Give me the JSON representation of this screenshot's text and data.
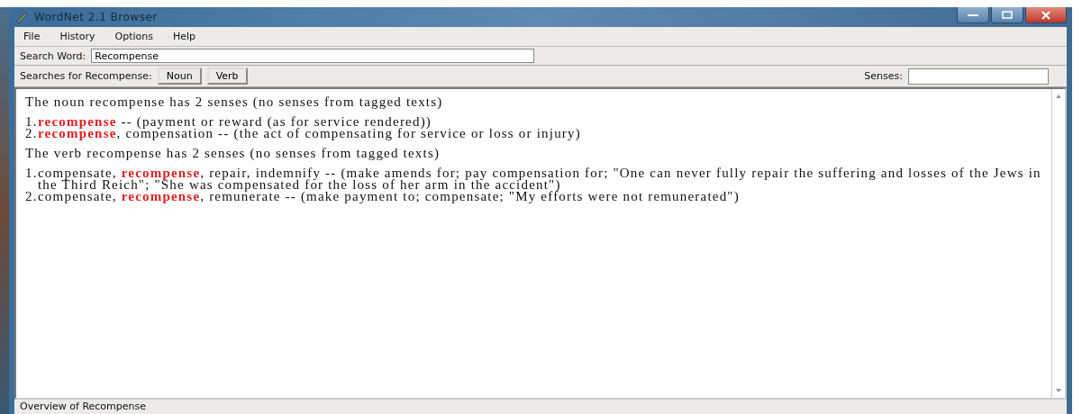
{
  "window": {
    "title": "WordNet 2.1 Browser"
  },
  "menu": [
    "File",
    "History",
    "Options",
    "Help"
  ],
  "search": {
    "label": "Search Word:",
    "value": "Recompense"
  },
  "searches": {
    "label": "Searches for Recompense:",
    "buttons": [
      "Noun",
      "Verb"
    ],
    "senses_label": "Senses:"
  },
  "sections": [
    {
      "heading": "The noun recompense has 2 senses (no senses from tagged texts)",
      "senses": [
        {
          "number": "1.",
          "text": "**recompense** -- (payment or reward (as for service rendered))"
        },
        {
          "number": "2.",
          "text": "**recompense**, compensation -- (the act of compensating for service or loss or injury)"
        }
      ]
    },
    {
      "heading": "The verb recompense has 2 senses (no senses from tagged texts)",
      "senses": [
        {
          "number": "1.",
          "text": "compensate, **recompense**, repair, indemnify -- (make amends for; pay compensation for; \"One can never fully repair the suffering and losses of the Jews in the Third Reich\"; \"She was compensated for the loss of her arm in the accident\")"
        },
        {
          "number": "2.",
          "text": "compensate, **recompense**, remunerate -- (make payment to; compensate; \"My efforts were not remunerated\")"
        }
      ]
    }
  ],
  "status_bar": "Overview of Recompense"
}
